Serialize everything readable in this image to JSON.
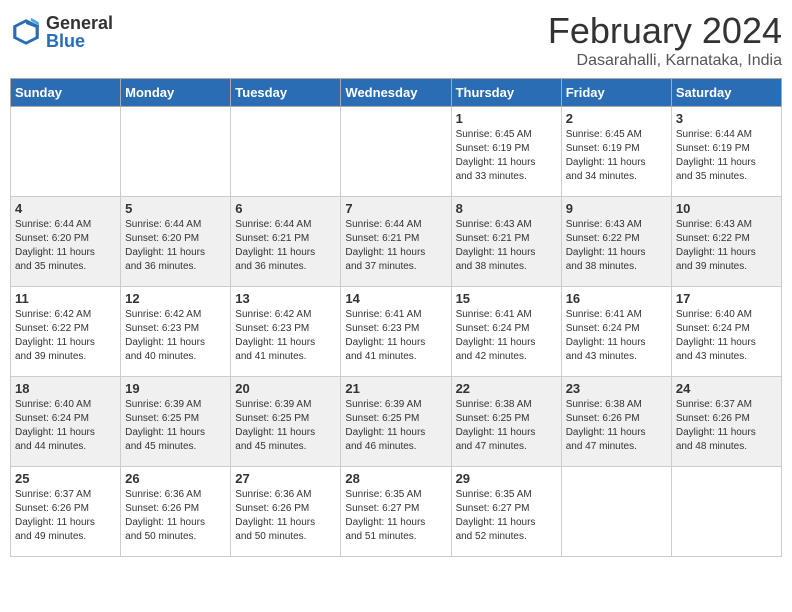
{
  "header": {
    "logo_general": "General",
    "logo_blue": "Blue",
    "month": "February 2024",
    "location": "Dasarahalli, Karnataka, India"
  },
  "days_of_week": [
    "Sunday",
    "Monday",
    "Tuesday",
    "Wednesday",
    "Thursday",
    "Friday",
    "Saturday"
  ],
  "weeks": [
    [
      {
        "day": "",
        "info": ""
      },
      {
        "day": "",
        "info": ""
      },
      {
        "day": "",
        "info": ""
      },
      {
        "day": "",
        "info": ""
      },
      {
        "day": "1",
        "info": "Sunrise: 6:45 AM\nSunset: 6:19 PM\nDaylight: 11 hours\nand 33 minutes."
      },
      {
        "day": "2",
        "info": "Sunrise: 6:45 AM\nSunset: 6:19 PM\nDaylight: 11 hours\nand 34 minutes."
      },
      {
        "day": "3",
        "info": "Sunrise: 6:44 AM\nSunset: 6:19 PM\nDaylight: 11 hours\nand 35 minutes."
      }
    ],
    [
      {
        "day": "4",
        "info": "Sunrise: 6:44 AM\nSunset: 6:20 PM\nDaylight: 11 hours\nand 35 minutes."
      },
      {
        "day": "5",
        "info": "Sunrise: 6:44 AM\nSunset: 6:20 PM\nDaylight: 11 hours\nand 36 minutes."
      },
      {
        "day": "6",
        "info": "Sunrise: 6:44 AM\nSunset: 6:21 PM\nDaylight: 11 hours\nand 36 minutes."
      },
      {
        "day": "7",
        "info": "Sunrise: 6:44 AM\nSunset: 6:21 PM\nDaylight: 11 hours\nand 37 minutes."
      },
      {
        "day": "8",
        "info": "Sunrise: 6:43 AM\nSunset: 6:21 PM\nDaylight: 11 hours\nand 38 minutes."
      },
      {
        "day": "9",
        "info": "Sunrise: 6:43 AM\nSunset: 6:22 PM\nDaylight: 11 hours\nand 38 minutes."
      },
      {
        "day": "10",
        "info": "Sunrise: 6:43 AM\nSunset: 6:22 PM\nDaylight: 11 hours\nand 39 minutes."
      }
    ],
    [
      {
        "day": "11",
        "info": "Sunrise: 6:42 AM\nSunset: 6:22 PM\nDaylight: 11 hours\nand 39 minutes."
      },
      {
        "day": "12",
        "info": "Sunrise: 6:42 AM\nSunset: 6:23 PM\nDaylight: 11 hours\nand 40 minutes."
      },
      {
        "day": "13",
        "info": "Sunrise: 6:42 AM\nSunset: 6:23 PM\nDaylight: 11 hours\nand 41 minutes."
      },
      {
        "day": "14",
        "info": "Sunrise: 6:41 AM\nSunset: 6:23 PM\nDaylight: 11 hours\nand 41 minutes."
      },
      {
        "day": "15",
        "info": "Sunrise: 6:41 AM\nSunset: 6:24 PM\nDaylight: 11 hours\nand 42 minutes."
      },
      {
        "day": "16",
        "info": "Sunrise: 6:41 AM\nSunset: 6:24 PM\nDaylight: 11 hours\nand 43 minutes."
      },
      {
        "day": "17",
        "info": "Sunrise: 6:40 AM\nSunset: 6:24 PM\nDaylight: 11 hours\nand 43 minutes."
      }
    ],
    [
      {
        "day": "18",
        "info": "Sunrise: 6:40 AM\nSunset: 6:24 PM\nDaylight: 11 hours\nand 44 minutes."
      },
      {
        "day": "19",
        "info": "Sunrise: 6:39 AM\nSunset: 6:25 PM\nDaylight: 11 hours\nand 45 minutes."
      },
      {
        "day": "20",
        "info": "Sunrise: 6:39 AM\nSunset: 6:25 PM\nDaylight: 11 hours\nand 45 minutes."
      },
      {
        "day": "21",
        "info": "Sunrise: 6:39 AM\nSunset: 6:25 PM\nDaylight: 11 hours\nand 46 minutes."
      },
      {
        "day": "22",
        "info": "Sunrise: 6:38 AM\nSunset: 6:25 PM\nDaylight: 11 hours\nand 47 minutes."
      },
      {
        "day": "23",
        "info": "Sunrise: 6:38 AM\nSunset: 6:26 PM\nDaylight: 11 hours\nand 47 minutes."
      },
      {
        "day": "24",
        "info": "Sunrise: 6:37 AM\nSunset: 6:26 PM\nDaylight: 11 hours\nand 48 minutes."
      }
    ],
    [
      {
        "day": "25",
        "info": "Sunrise: 6:37 AM\nSunset: 6:26 PM\nDaylight: 11 hours\nand 49 minutes."
      },
      {
        "day": "26",
        "info": "Sunrise: 6:36 AM\nSunset: 6:26 PM\nDaylight: 11 hours\nand 50 minutes."
      },
      {
        "day": "27",
        "info": "Sunrise: 6:36 AM\nSunset: 6:26 PM\nDaylight: 11 hours\nand 50 minutes."
      },
      {
        "day": "28",
        "info": "Sunrise: 6:35 AM\nSunset: 6:27 PM\nDaylight: 11 hours\nand 51 minutes."
      },
      {
        "day": "29",
        "info": "Sunrise: 6:35 AM\nSunset: 6:27 PM\nDaylight: 11 hours\nand 52 minutes."
      },
      {
        "day": "",
        "info": ""
      },
      {
        "day": "",
        "info": ""
      }
    ]
  ]
}
